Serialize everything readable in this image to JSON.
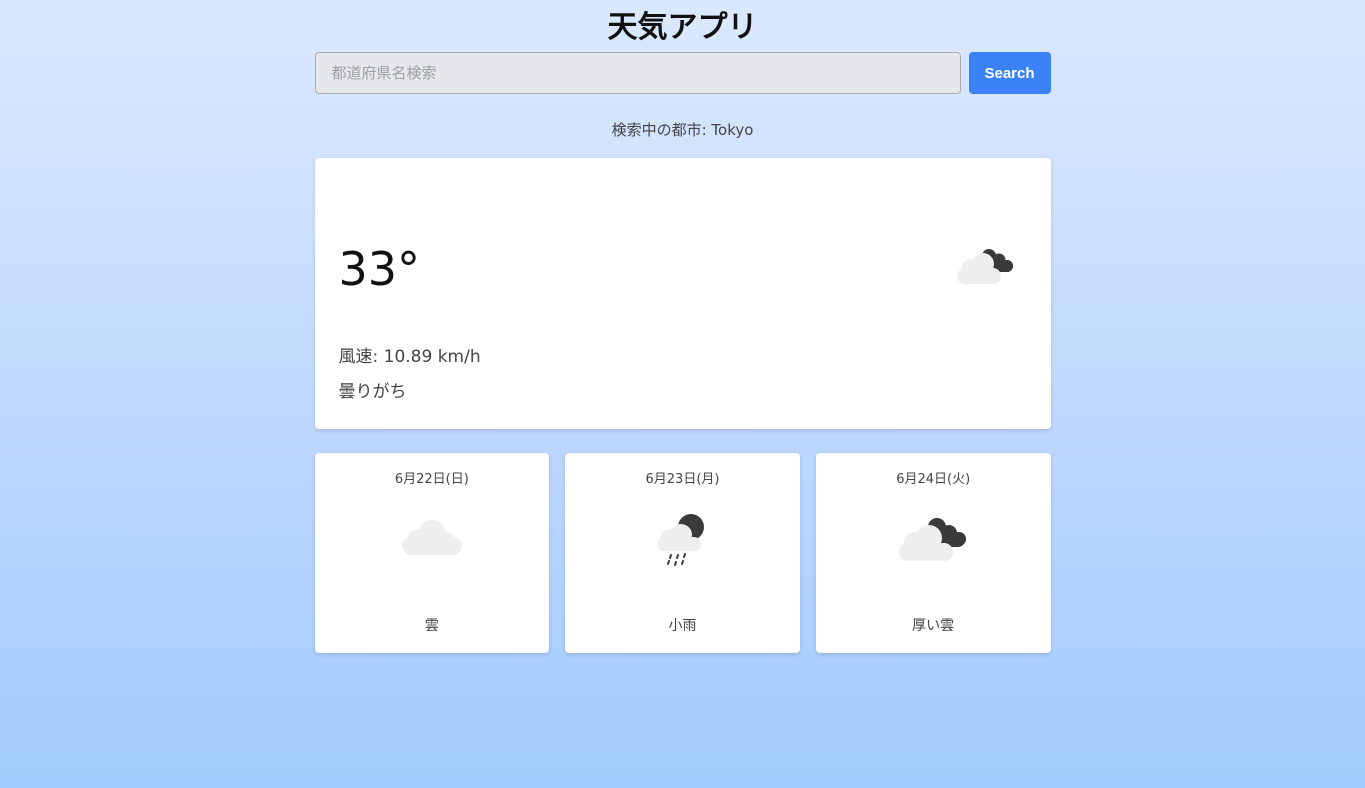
{
  "app": {
    "title": "天気アプリ"
  },
  "search": {
    "placeholder": "都道府県名検索",
    "value": "",
    "button_label": "Search"
  },
  "city_line": "検索中の都市: Tokyo",
  "current": {
    "temperature": "33°",
    "wind": "風速: 10.89 km/h",
    "description": "曇りがち",
    "icon": "broken-clouds-icon"
  },
  "forecast": [
    {
      "date": "6月22日(日)",
      "description": "雲",
      "icon": "cloud-icon"
    },
    {
      "date": "6月23日(月)",
      "description": "小雨",
      "icon": "light-rain-icon"
    },
    {
      "date": "6月24日(火)",
      "description": "厚い雲",
      "icon": "broken-clouds-icon"
    }
  ],
  "colors": {
    "accent": "#3b82f6",
    "cloud_light": "#eeeeee",
    "cloud_dark": "#3a3a3a"
  }
}
